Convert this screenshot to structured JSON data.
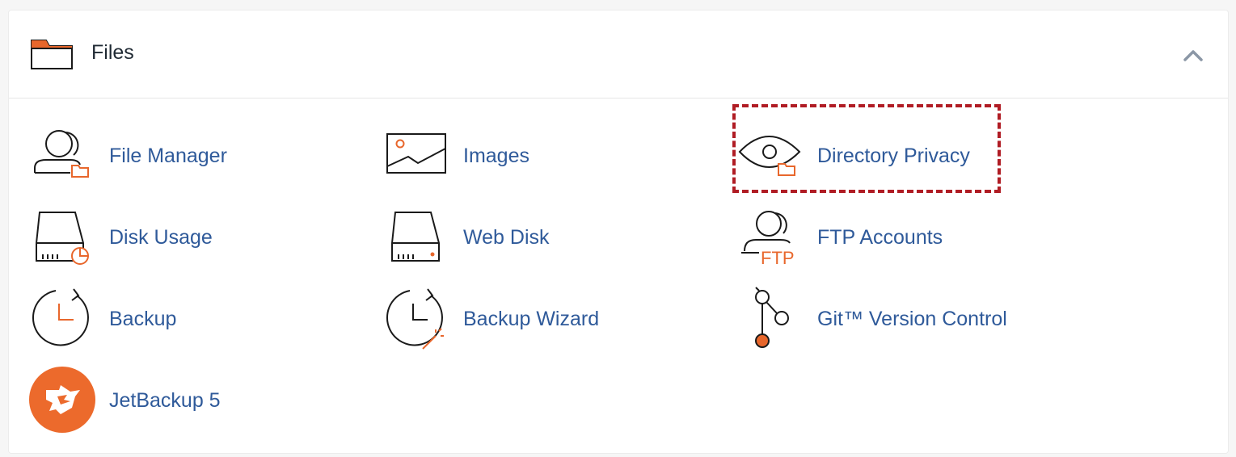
{
  "section": {
    "title": "Files",
    "icon": "folder-icon",
    "collapse_icon": "chevron-up-icon"
  },
  "items": [
    {
      "label": "File Manager",
      "icon": "file-manager-icon"
    },
    {
      "label": "Images",
      "icon": "images-icon"
    },
    {
      "label": "Directory Privacy",
      "icon": "directory-privacy-icon",
      "highlighted": true
    },
    {
      "label": "Disk Usage",
      "icon": "disk-usage-icon"
    },
    {
      "label": "Web Disk",
      "icon": "web-disk-icon"
    },
    {
      "label": "FTP Accounts",
      "icon": "ftp-accounts-icon"
    },
    {
      "label": "Backup",
      "icon": "backup-icon"
    },
    {
      "label": "Backup Wizard",
      "icon": "backup-wizard-icon"
    },
    {
      "label": "Git™ Version Control",
      "icon": "git-icon"
    },
    {
      "label": "JetBackup 5",
      "icon": "jetbackup-icon"
    }
  ],
  "ftp_icon_text": "FTP",
  "colors": {
    "accent": "#e8672c",
    "link": "#2f5a9a",
    "highlight_border": "#b01c24"
  }
}
